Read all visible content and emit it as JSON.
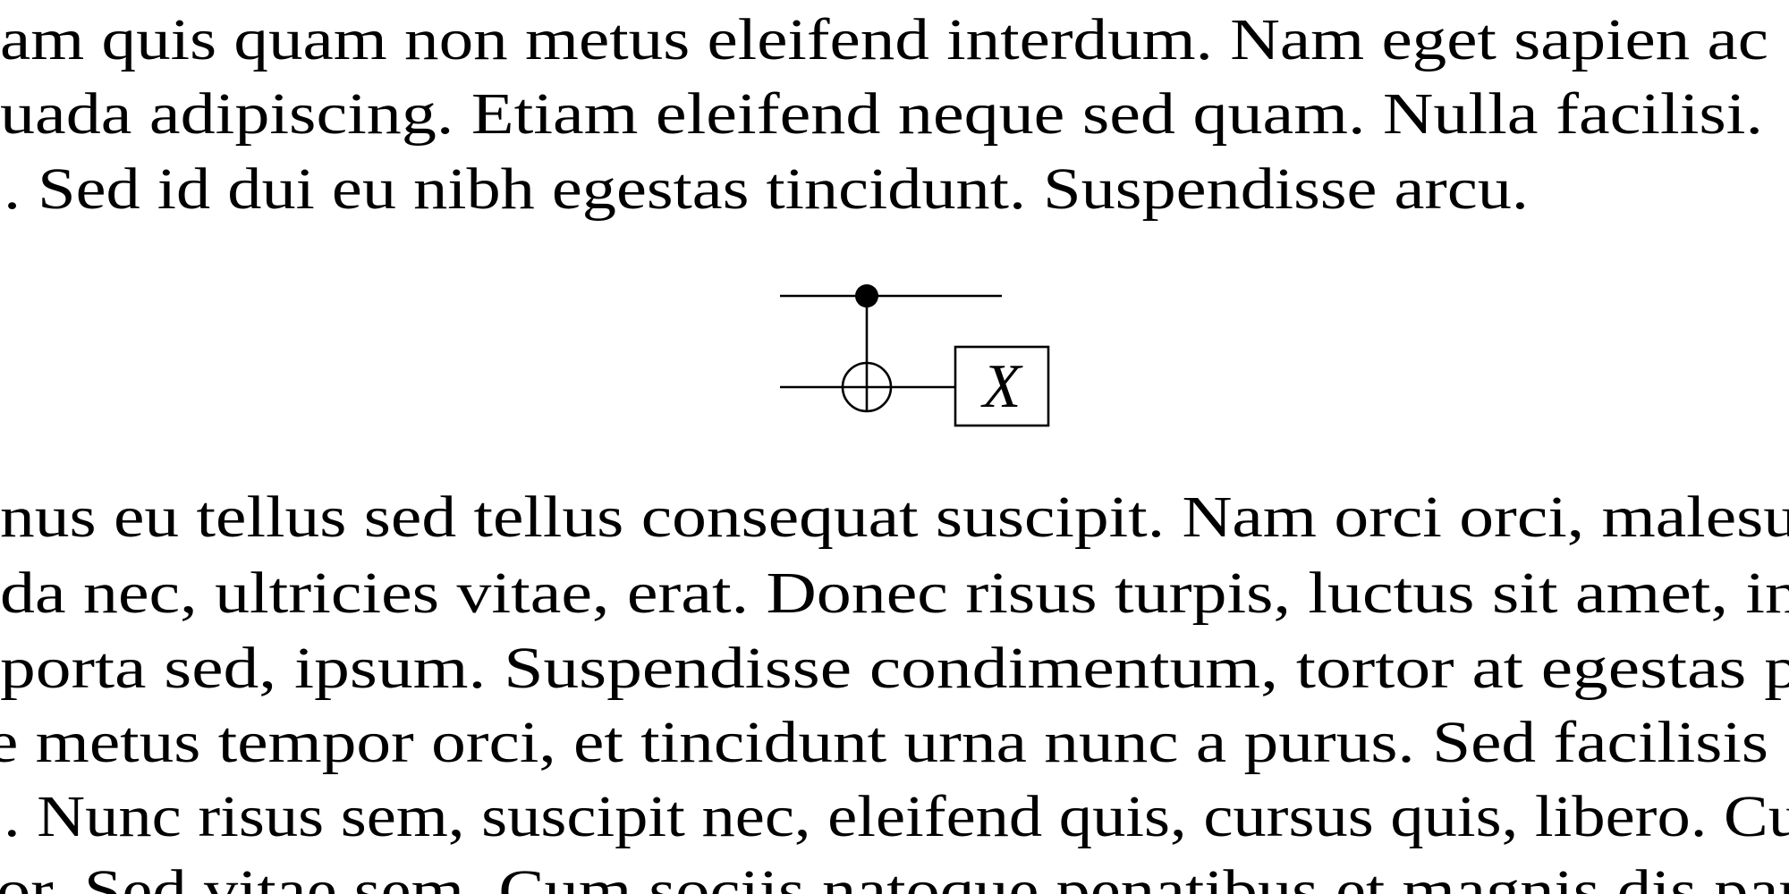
{
  "paragraph_top": {
    "lines": [
      "am quis quam non metus eleifend interdum. Nam eget sapien ac",
      "uada adipiscing. Etiam eleifend neque sed quam. Nulla facilisi.",
      ". Sed id dui eu nibh egestas tincidunt. Suspendisse arcu."
    ]
  },
  "figure": {
    "type": "quantum-circuit",
    "gates": [
      "CNOT (control on qubit 1, target on qubit 2)",
      "X on qubit 2"
    ],
    "gate_label": "X"
  },
  "paragraph_bottom": {
    "lines": [
      "nus eu tellus sed tellus consequat suscipit. Nam orci orci, malesu",
      "da nec, ultricies vitae, erat. Donec risus turpis, luctus sit amet, in",
      "porta sed, ipsum. Suspendisse condimentum, tortor at egestas p",
      "e metus tempor orci, et tincidunt urna nunc a purus. Sed facilisis",
      ". Nunc risus sem, suscipit nec, eleifend quis, cursus quis, libero. Cu",
      "or. Sed vitae sem. Cum sociis natoque penatibus et magnis dis par"
    ]
  }
}
